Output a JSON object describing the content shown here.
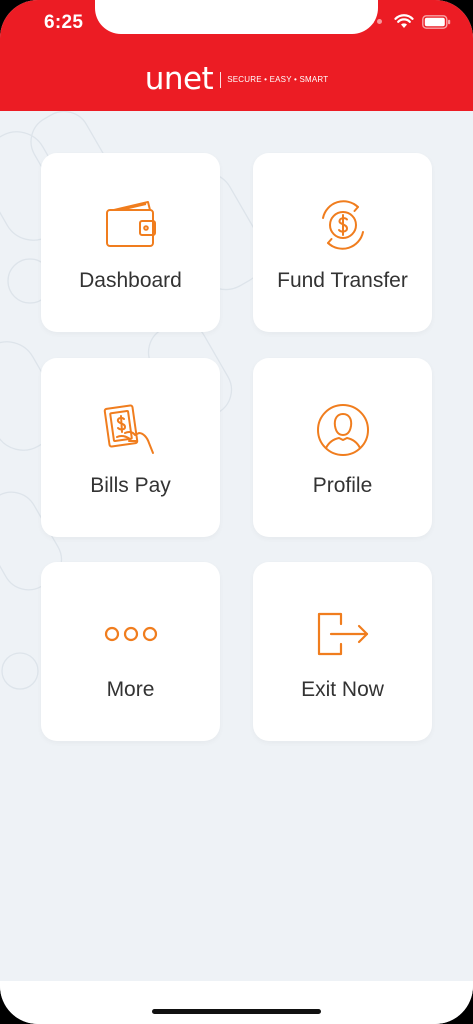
{
  "status_bar": {
    "time": "6:25"
  },
  "header": {
    "logo_text": "unet",
    "tagline": "SECURE • EASY • SMART",
    "brand_color": "#ec1c24"
  },
  "accent_color": "#f07d1e",
  "menu": [
    {
      "label": "Dashboard",
      "icon": "wallet-icon"
    },
    {
      "label": "Fund Transfer",
      "icon": "dollar-exchange-icon"
    },
    {
      "label": "Bills Pay",
      "icon": "cash-hand-icon"
    },
    {
      "label": "Profile",
      "icon": "user-icon"
    },
    {
      "label": "More",
      "icon": "more-dots-icon"
    },
    {
      "label": "Exit Now",
      "icon": "exit-icon"
    }
  ]
}
